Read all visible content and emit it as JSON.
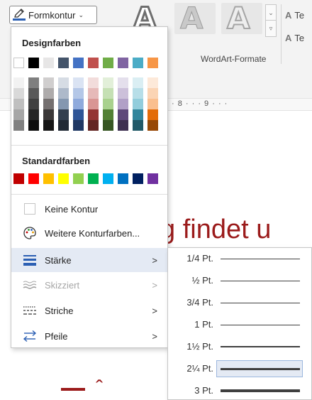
{
  "ribbon": {
    "wordart_glyph": "A",
    "group_label": "WordArt-Formate",
    "text_effect_1": "Te",
    "text_effect_2": "Te",
    "ruler_text": "· 8 · · · 9 · · ·"
  },
  "shape_outline_button": {
    "label": "Formkontur",
    "icon": "pen-underline-icon"
  },
  "menu": {
    "theme_colors_title": "Designfarben",
    "theme_colors": [
      "#ffffff",
      "#000000",
      "#e7e6e6",
      "#44546a",
      "#4472c4",
      "#c0504d",
      "#70ad47",
      "#8064a2",
      "#4bacc6",
      "#f79646"
    ],
    "theme_shades": [
      [
        "#f2f2f2",
        "#d9d9d9",
        "#bfbfbf",
        "#a6a6a6",
        "#808080"
      ],
      [
        "#7f7f7f",
        "#595959",
        "#404040",
        "#262626",
        "#0d0d0d"
      ],
      [
        "#d0cece",
        "#aeabab",
        "#757070",
        "#3b3838",
        "#161616"
      ],
      [
        "#d6dce4",
        "#adb9ca",
        "#8497b0",
        "#333f4f",
        "#222a35"
      ],
      [
        "#dae3f3",
        "#b4c7e7",
        "#8faadc",
        "#2f5597",
        "#1f3864"
      ],
      [
        "#f2dcdb",
        "#e6b9b8",
        "#d99694",
        "#943634",
        "#632523"
      ],
      [
        "#e2efd9",
        "#c5e0b4",
        "#a9d18e",
        "#538135",
        "#375623"
      ],
      [
        "#e4dfec",
        "#ccc0da",
        "#b1a0c7",
        "#5f497a",
        "#3f3151"
      ],
      [
        "#daeef3",
        "#b7dee8",
        "#92cddc",
        "#31859c",
        "#215968"
      ],
      [
        "#fde9d9",
        "#fbd4b4",
        "#fabf8f",
        "#e36c09",
        "#974806"
      ]
    ],
    "standard_colors_title": "Standardfarben",
    "standard_colors": [
      "#c00000",
      "#ff0000",
      "#ffc000",
      "#ffff00",
      "#92d050",
      "#00b050",
      "#00b0f0",
      "#0070c0",
      "#002060",
      "#7030a0"
    ],
    "items": [
      {
        "label": "Keine Kontur",
        "icon": "empty-box-icon",
        "has_submenu": false
      },
      {
        "label": "Weitere Konturfarben...",
        "icon": "palette-icon",
        "has_submenu": false
      },
      {
        "label": "Stärke",
        "icon": "line-weight-icon",
        "has_submenu": true
      },
      {
        "label": "Skizziert",
        "icon": "sketched-line-icon",
        "has_submenu": true
      },
      {
        "label": "Striche",
        "icon": "dash-icon",
        "has_submenu": true
      },
      {
        "label": "Pfeile",
        "icon": "arrows-icon",
        "has_submenu": true
      }
    ],
    "submenu_arrow": ">"
  },
  "weight_submenu": {
    "items": [
      {
        "label": "1/4 Pt.",
        "weight_pt": 0.25,
        "selected": false
      },
      {
        "label": "½ Pt.",
        "weight_pt": 0.5,
        "selected": false
      },
      {
        "label": "3/4 Pt.",
        "weight_pt": 0.75,
        "selected": false
      },
      {
        "label": "1 Pt.",
        "weight_pt": 1,
        "selected": false
      },
      {
        "label": "1½ Pt.",
        "weight_pt": 1.5,
        "selected": false
      },
      {
        "label": "2¼ Pt.",
        "weight_pt": 2.25,
        "selected": true
      },
      {
        "label": "3 Pt.",
        "weight_pt": 3,
        "selected": false
      }
    ]
  },
  "document": {
    "visible_text": "g findet u",
    "fragment_text": "̂"
  }
}
